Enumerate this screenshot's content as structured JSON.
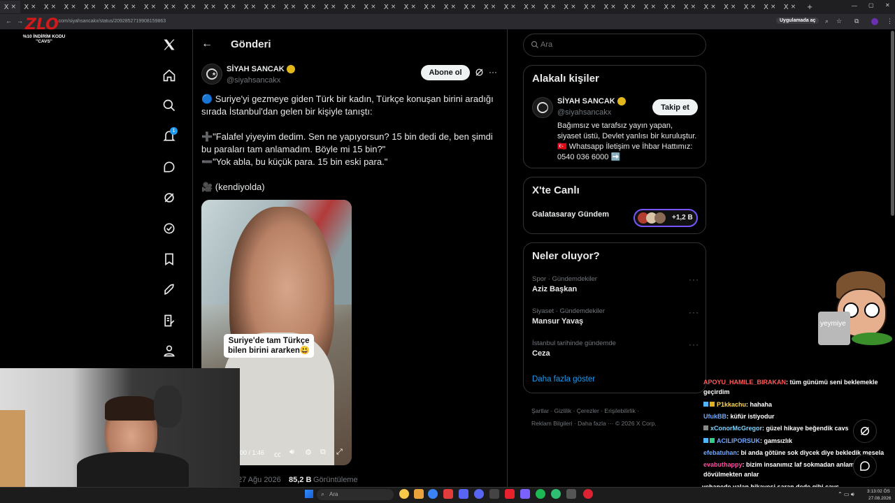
{
  "browser": {
    "tab_glyph": "X",
    "tab_close": "×",
    "new_tab": "+",
    "url": "x.com/siyahsancakx/status/2092852719908159863",
    "app_pill": "Uygulamada aç",
    "minimize": "—",
    "restore": "▢",
    "close": "✕"
  },
  "overlay": {
    "logo_text": "%10 İNDİRİM KODU",
    "logo_code": "\"CAVS\""
  },
  "header": {
    "back_icon": "arrow-left-icon",
    "title": "Gönderi"
  },
  "post": {
    "author_name": "SİYAH SANCAK",
    "author_handle": "@siyahsancakx",
    "subscribe_label": "Abone ol",
    "more": "···",
    "line1": "🔵 Suriye'yi gezmeye giden Türk bir kadın, Türkçe konuşan birini aradığı sırada İstanbul'dan gelen bir kişiyle tanıştı:",
    "line2": "➕\"Falafel yiyeyim dedim. Sen ne yapıyorsun? 15 bin dedi de, ben şimdi bu paraları tam anlamadım. Böyle mi 15 bin?\"",
    "line3": "➖\"Yok abla, bu küçük para. 15 bin eski para.\"",
    "line4": "🎥 (kendiyolda)",
    "video_caption_1": "Suriye'de tam Türkçe",
    "video_caption_2": "bilen birini ararken😃",
    "video_time": "00 / 1:46",
    "date": "27 Ağu 2026",
    "views_value": "85,2 B",
    "views_label": "Görüntüleme"
  },
  "search": {
    "placeholder": "Ara"
  },
  "related": {
    "title": "Alakalı kişiler",
    "name": "SİYAH SANCAK",
    "handle": "@siyahsancakx",
    "follow_label": "Takip et",
    "bio": "Bağımsız ve tarafsız yayın yapan, siyaset üstü, Devlet yanlısı bir kuruluştur. 🇹🇷 Whatsapp İletişim ve İhbar Hattımız: 0540 036 6000 ➡️"
  },
  "live": {
    "title": "X'te Canlı",
    "item": "Galatasaray Gündem",
    "count": "+1,2 B"
  },
  "trends": {
    "title": "Neler oluyor?",
    "items": [
      {
        "category": "Spor · Gündemdekiler",
        "name": "Aziz Başkan"
      },
      {
        "category": "Siyaset · Gündemdekiler",
        "name": "Mansur Yavaş"
      },
      {
        "category": "İstanbul tarihinde gündemde",
        "name": "Ceza"
      }
    ],
    "more": "Daha fazla göster"
  },
  "footer": {
    "links": [
      "Şartlar",
      "Gizlilik",
      "Çerezler",
      "Erişilebilirlik",
      "Reklam Bilgileri",
      "Daha fazla ···"
    ],
    "copyright": "© 2026 X Corp."
  },
  "streamer": {
    "sign_text": "yeymiye"
  },
  "chat": [
    {
      "user": "APOYU_HAMILE_BIRAKAN",
      "color": "#ff5a5a",
      "msg": ": tüm günümü seni beklemekle geçirdim"
    },
    {
      "user": "P1kkachu",
      "color": "#ffd84d",
      "msg": ": hahaha"
    },
    {
      "user": "UfukBB",
      "color": "#6fa8ff",
      "msg": ": küfür istiyodur"
    },
    {
      "user": "xConorMcGregor",
      "color": "#7fd4ff",
      "msg": ": güzel hikaye beğendik cavs"
    },
    {
      "user": "ACILIPORSUK",
      "color": "#6fa8ff",
      "msg": ": gamsızlık"
    },
    {
      "user": "efebatuhan",
      "color": "#6fa8ff",
      "msg": ": bi anda götüne sok diycek diye bekledik mesela"
    },
    {
      "user": "evabuthappy",
      "color": "#ff4fa0",
      "msg": ": bizim insanımız laf sokmadan anlamaz dövülmekten anlar"
    },
    {
      "user": "",
      "color": "#ffffff",
      "msg": "vehanede yalan hikayesi saran dede gibi cavs"
    }
  ],
  "taskbar": {
    "search_placeholder": "Ara",
    "time": "3:13:02 ÖS",
    "date": "27.08.2026"
  }
}
